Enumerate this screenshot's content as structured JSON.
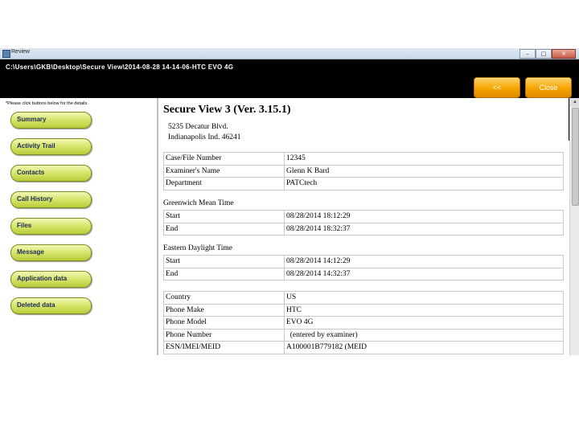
{
  "window": {
    "title": "Review",
    "controls": {
      "minimize": "–",
      "maximize": "□",
      "close": "✕"
    }
  },
  "header": {
    "path": "C:\\Users\\GKB\\Desktop\\Secure View\\2014-08-28 14-14-06-HTC EVO 4G",
    "back_label": "<<",
    "close_label": "Close"
  },
  "sidebar": {
    "hint": "*Please click buttons below for the details.",
    "items": [
      {
        "label": "Summary"
      },
      {
        "label": "Activity Trail"
      },
      {
        "label": "Contacts"
      },
      {
        "label": "Call History"
      },
      {
        "label": "Files"
      },
      {
        "label": "Message"
      },
      {
        "label": "Application data"
      },
      {
        "label": "Deleted data"
      }
    ]
  },
  "report": {
    "title": "Secure View 3 (Ver. 3.15.1)",
    "address_line1": "5235 Decatur Blvd.",
    "address_line2": "Indianapolis Ind. 46241",
    "case_table": [
      {
        "key": "Case/File Number",
        "value": "12345"
      },
      {
        "key": "Examiner's Name",
        "value": "Glenn K Bard"
      },
      {
        "key": "Department",
        "value": "PATCtech"
      }
    ],
    "gmt_label": "Greenwich Mean Time",
    "gmt_table": [
      {
        "key": "Start",
        "value": "08/28/2014 18:12:29"
      },
      {
        "key": "End",
        "value": "08/28/2014 18:32:37"
      }
    ],
    "edt_label": "Eastern Daylight Time",
    "edt_table": [
      {
        "key": "Start",
        "value": "08/28/2014 14:12:29"
      },
      {
        "key": "End",
        "value": "08/28/2014 14:32:37"
      }
    ],
    "phone_table": [
      {
        "key": "Country",
        "value": "US"
      },
      {
        "key": "Phone Make",
        "value": "HTC"
      },
      {
        "key": "Phone Model",
        "value": "EVO 4G"
      },
      {
        "key": "Phone Number",
        "value": "  (entered by examiner)"
      },
      {
        "key": "ESN/IMEI/MEID",
        "value": "A100001B779182 (MEID"
      }
    ]
  }
}
